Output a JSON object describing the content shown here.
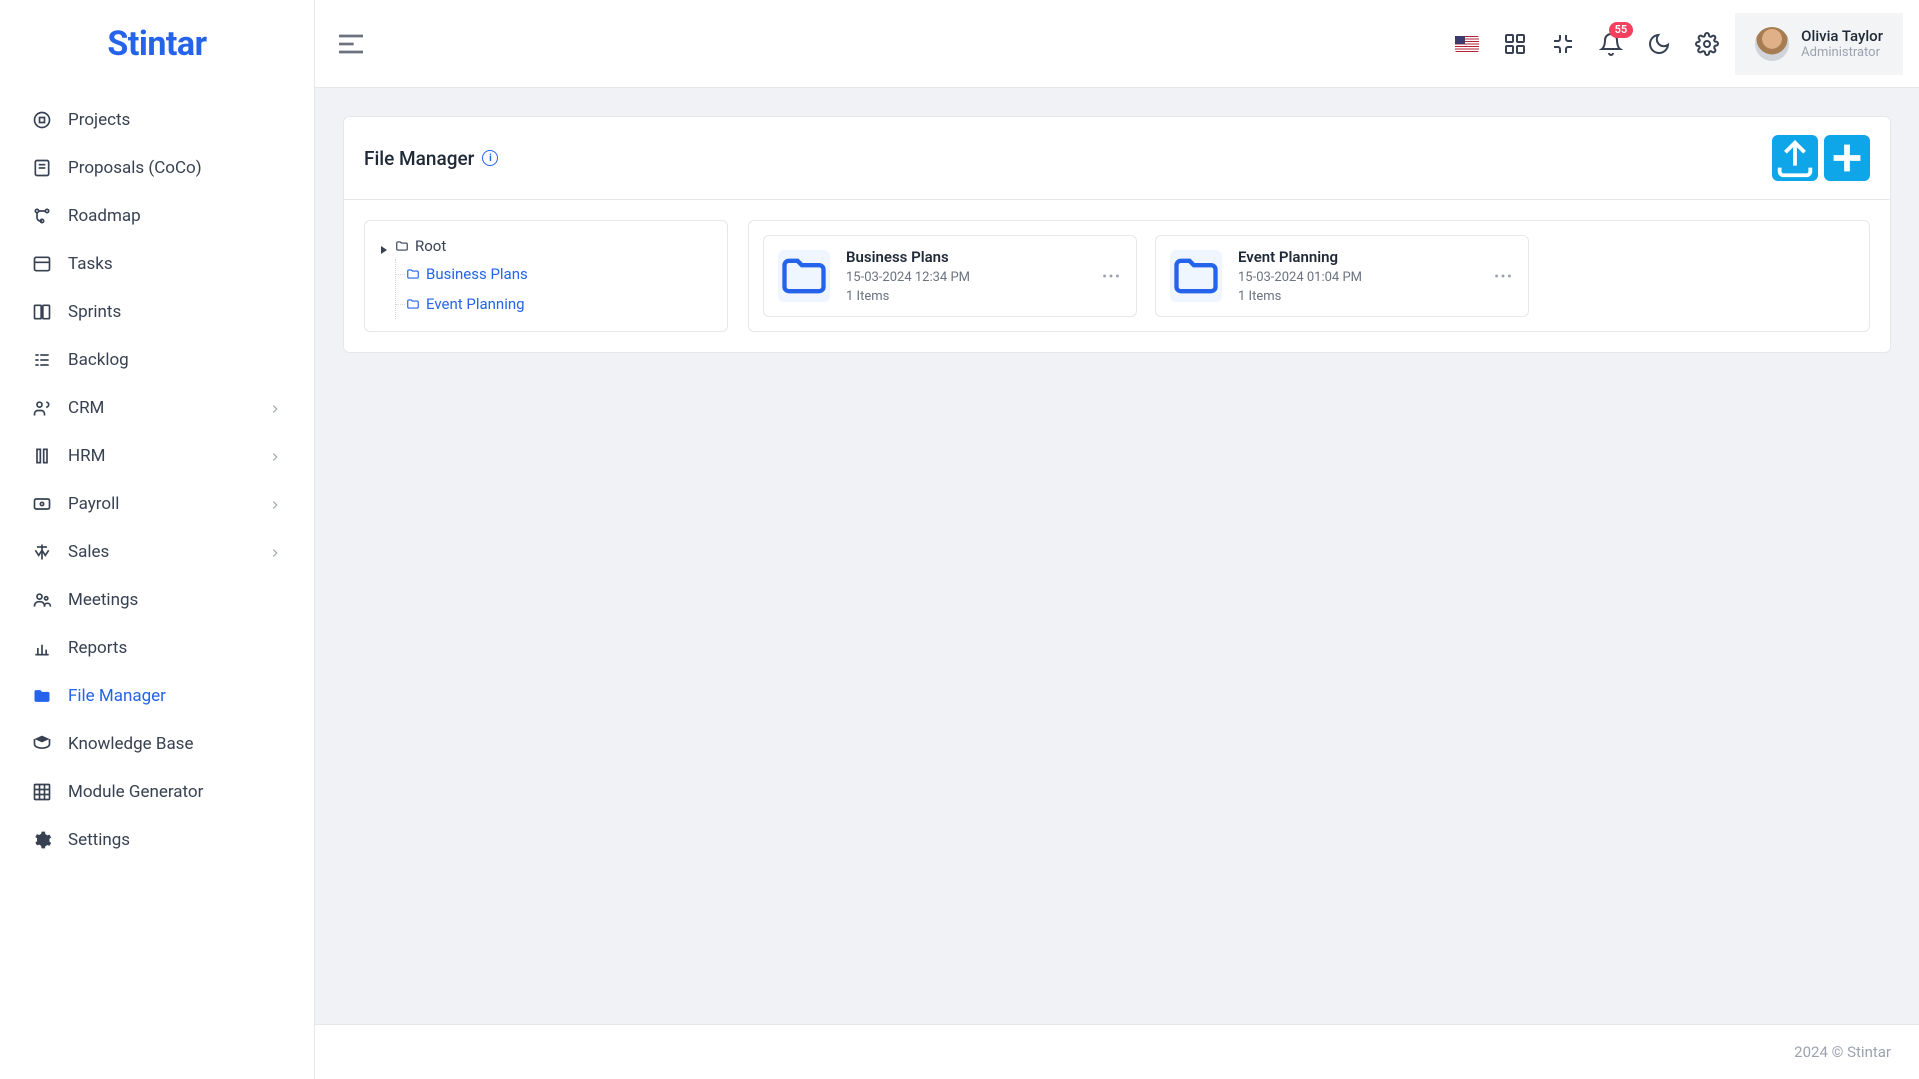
{
  "brand": "Stintar",
  "header": {
    "notification_count": "55",
    "user_name": "Olivia Taylor",
    "user_role": "Administrator"
  },
  "sidebar": {
    "items": [
      {
        "label": "Projects",
        "icon": "project",
        "expandable": false,
        "active": false
      },
      {
        "label": "Proposals (CoCo)",
        "icon": "proposal",
        "expandable": false,
        "active": false
      },
      {
        "label": "Roadmap",
        "icon": "roadmap",
        "expandable": false,
        "active": false
      },
      {
        "label": "Tasks",
        "icon": "tasks",
        "expandable": false,
        "active": false
      },
      {
        "label": "Sprints",
        "icon": "sprints",
        "expandable": false,
        "active": false
      },
      {
        "label": "Backlog",
        "icon": "backlog",
        "expandable": false,
        "active": false
      },
      {
        "label": "CRM",
        "icon": "crm",
        "expandable": true,
        "active": false
      },
      {
        "label": "HRM",
        "icon": "hrm",
        "expandable": true,
        "active": false
      },
      {
        "label": "Payroll",
        "icon": "payroll",
        "expandable": true,
        "active": false
      },
      {
        "label": "Sales",
        "icon": "sales",
        "expandable": true,
        "active": false
      },
      {
        "label": "Meetings",
        "icon": "meetings",
        "expandable": false,
        "active": false
      },
      {
        "label": "Reports",
        "icon": "reports",
        "expandable": false,
        "active": false
      },
      {
        "label": "File Manager",
        "icon": "file-manager",
        "expandable": false,
        "active": true
      },
      {
        "label": "Knowledge Base",
        "icon": "knowledge",
        "expandable": false,
        "active": false
      },
      {
        "label": "Module Generator",
        "icon": "module",
        "expandable": false,
        "active": false
      },
      {
        "label": "Settings",
        "icon": "settings",
        "expandable": false,
        "active": false
      }
    ]
  },
  "page": {
    "title": "File Manager",
    "tree": {
      "root_label": "Root",
      "children": [
        {
          "label": "Business Plans"
        },
        {
          "label": "Event Planning"
        }
      ]
    },
    "folders": [
      {
        "name": "Business Plans",
        "date": "15-03-2024 12:34 PM",
        "items": "1 Items"
      },
      {
        "name": "Event Planning",
        "date": "15-03-2024 01:04 PM",
        "items": "1 Items"
      }
    ]
  },
  "footer": "2024 © Stintar"
}
